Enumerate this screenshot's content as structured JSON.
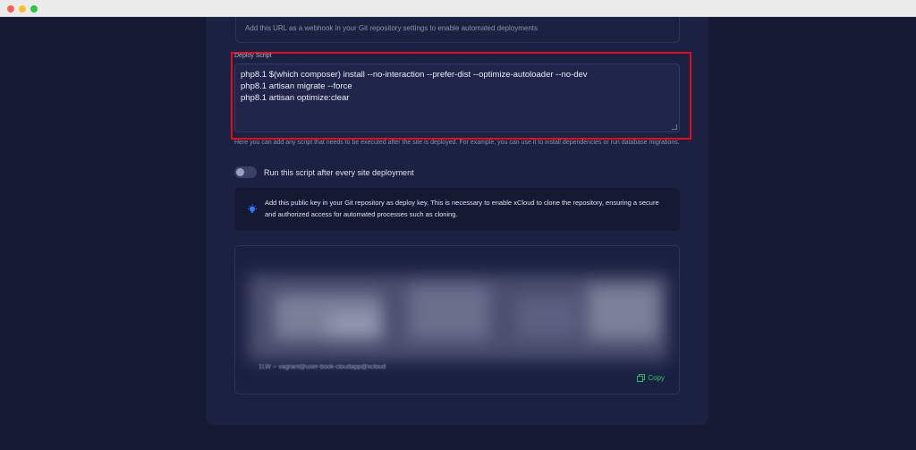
{
  "webhook": {
    "help": "Add this URL as a webhook in your Git repository settings to enable automated deployments"
  },
  "deploy_script": {
    "label": "Deploy Script",
    "lines": [
      "php8.1 $(which composer) install --no-interaction --prefer-dist --optimize-autoloader --no-dev",
      "php8.1 artisan migrate --force",
      "php8.1 artisan optimize:clear"
    ],
    "help": "Here you can add any script that needs to be executed after the site is deployed. For example, you can use it to install dependencies or run database migrations."
  },
  "toggle": {
    "label": "Run this script after every site deployment",
    "enabled": false
  },
  "info": {
    "icon": "lightbulb-icon",
    "text": "Add this public key in your Git repository as deploy key. This is necessary to enable xCloud to clone the repository, ensuring a secure and authorized access for automated processes such as cloning."
  },
  "key_box": {
    "tail_text": "1LW -- vagrant@user-book-cloudapp@xcloud",
    "copy_label": "Copy"
  },
  "colors": {
    "background": "#151a33",
    "card": "#1b2140",
    "highlight": "#e30b1c",
    "copy": "#2fc26e"
  }
}
